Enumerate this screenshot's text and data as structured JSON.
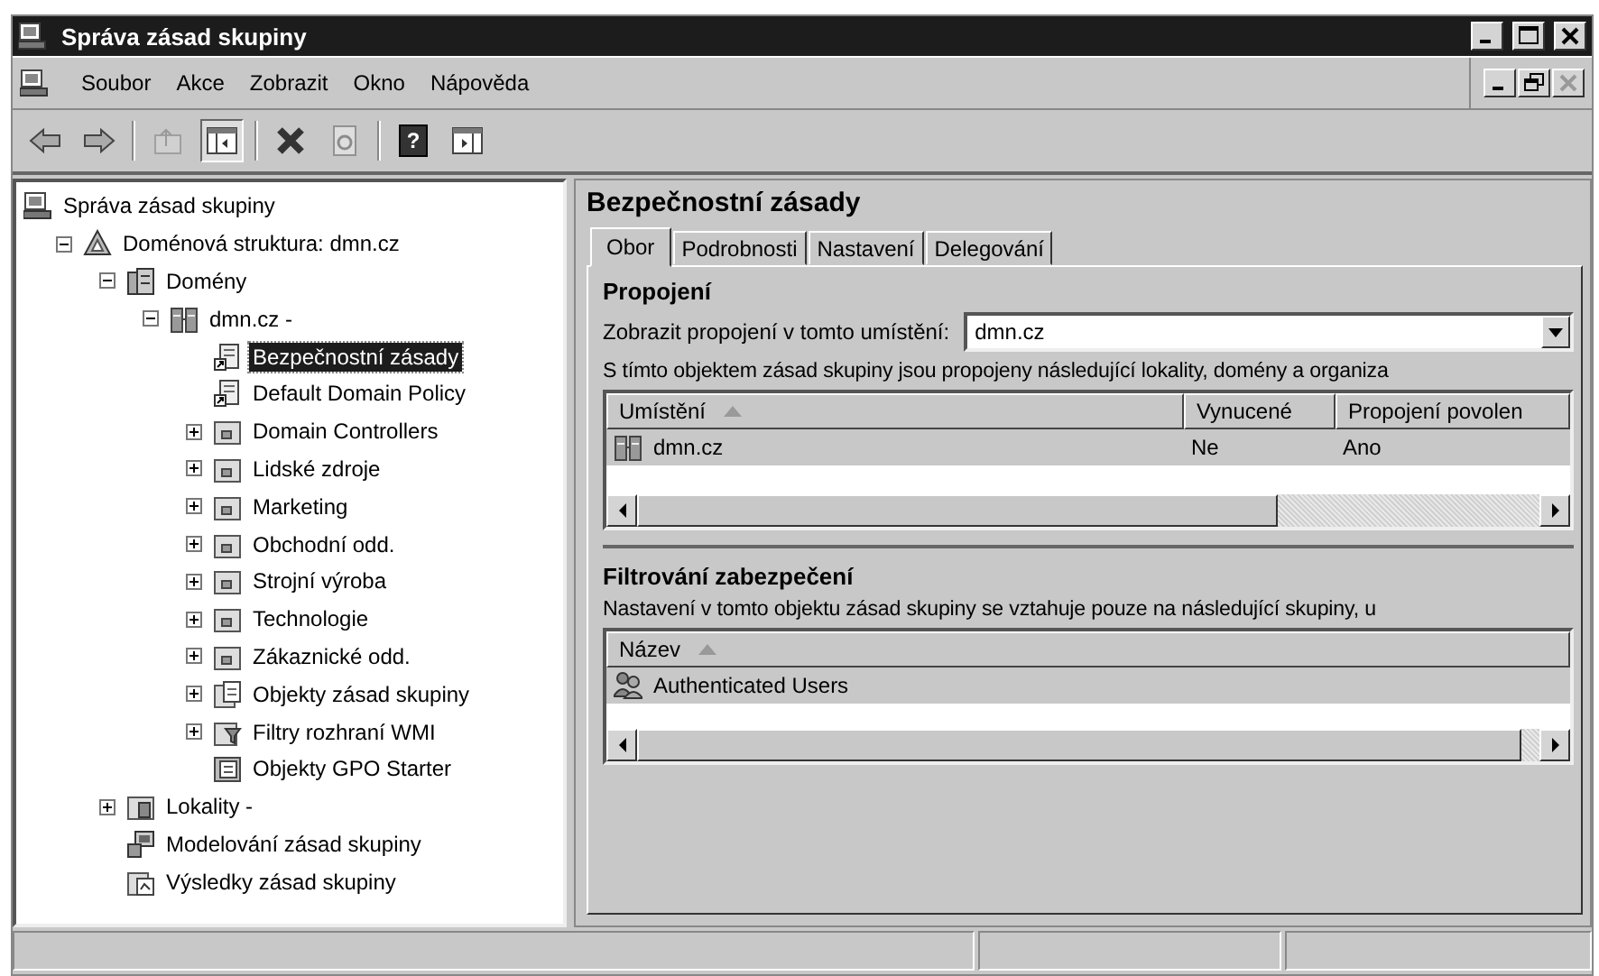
{
  "window": {
    "title": "Správa zásad skupiny"
  },
  "menu": [
    "Soubor",
    "Akce",
    "Zobrazit",
    "Okno",
    "Nápověda"
  ],
  "toolbar": [
    {
      "kind": "back",
      "disabled": false,
      "pressed": false
    },
    {
      "kind": "forward",
      "disabled": false,
      "pressed": false
    },
    {
      "kind": "separator"
    },
    {
      "kind": "up",
      "disabled": true,
      "pressed": false
    },
    {
      "kind": "tree-toggle",
      "disabled": false,
      "pressed": true
    },
    {
      "kind": "separator"
    },
    {
      "kind": "delete",
      "disabled": false,
      "pressed": false
    },
    {
      "kind": "refresh",
      "disabled": true,
      "pressed": false
    },
    {
      "kind": "separator"
    },
    {
      "kind": "help",
      "disabled": false,
      "pressed": false,
      "glyph": "?"
    },
    {
      "kind": "action-toggle",
      "disabled": false,
      "pressed": false
    }
  ],
  "tree": [
    {
      "label": "Správa zásad skupiny",
      "kind": "console",
      "selected": false,
      "children": [
        {
          "label": "Doménová struktura: dmn.cz",
          "kind": "forest",
          "expanded": true,
          "selected": false,
          "children": [
            {
              "label": "Domény",
              "kind": "domains",
              "expanded": true,
              "selected": false,
              "children": [
                {
                  "label": "dmn.cz -",
                  "kind": "domain",
                  "expanded": true,
                  "selected": false,
                  "children": [
                    {
                      "label": "Bezpečnostní zásady",
                      "kind": "gpo-link",
                      "selected": true
                    },
                    {
                      "label": "Default Domain Policy",
                      "kind": "gpo-link",
                      "selected": false
                    },
                    {
                      "label": "Domain Controllers",
                      "kind": "ou",
                      "expanded": false,
                      "selected": false
                    },
                    {
                      "label": "Lidské zdroje",
                      "kind": "ou",
                      "expanded": false,
                      "selected": false
                    },
                    {
                      "label": "Marketing",
                      "kind": "ou",
                      "expanded": false,
                      "selected": false
                    },
                    {
                      "label": "Obchodní odd.",
                      "kind": "ou",
                      "expanded": false,
                      "selected": false
                    },
                    {
                      "label": "Strojní výroba",
                      "kind": "ou",
                      "expanded": false,
                      "selected": false
                    },
                    {
                      "label": "Technologie",
                      "kind": "ou",
                      "expanded": false,
                      "selected": false
                    },
                    {
                      "label": "Zákaznické odd.",
                      "kind": "ou",
                      "expanded": false,
                      "selected": false
                    },
                    {
                      "label": "Objekty zásad skupiny",
                      "kind": "gpo-folder",
                      "expanded": false,
                      "selected": false
                    },
                    {
                      "label": "Filtry rozhraní WMI",
                      "kind": "wmi-folder",
                      "expanded": false,
                      "selected": false
                    },
                    {
                      "label": "Objekty GPO Starter",
                      "kind": "starter",
                      "selected": false
                    }
                  ]
                }
              ]
            },
            {
              "label": "Lokality -",
              "kind": "sites",
              "expanded": false,
              "selected": false
            },
            {
              "label": "Modelování zásad skupiny",
              "kind": "modeling",
              "selected": false
            },
            {
              "label": "Výsledky zásad skupiny",
              "kind": "results",
              "selected": false
            }
          ]
        }
      ]
    }
  ],
  "details": {
    "title": "Bezpečnostní zásady",
    "tabs": [
      {
        "label": "Obor",
        "selected": true
      },
      {
        "label": "Podrobnosti",
        "selected": false
      },
      {
        "label": "Nastavení",
        "selected": false
      },
      {
        "label": "Delegování",
        "selected": false
      }
    ],
    "sections": [
      {
        "heading": "Propojení",
        "combo": {
          "label": "Zobrazit propojení v tomto umístění:",
          "value": "dmn.cz"
        },
        "text": "S tímto objektem zásad skupiny jsou propojeny následující lokality, domény a organiza",
        "columns": [
          {
            "label": "Umístění",
            "sorted": true
          },
          {
            "label": "Vynucené",
            "sorted": false
          },
          {
            "label": "Propojení povolen",
            "sorted": false
          }
        ],
        "rows": [
          {
            "kind": "domain",
            "selected": true,
            "cells": [
              "dmn.cz",
              "Ne",
              "Ano"
            ]
          }
        ]
      },
      {
        "heading": "Filtrování zabezpečení",
        "text": "Nastavení v tomto objektu zásad skupiny se vztahuje pouze na následující skupiny, u",
        "columns": [
          {
            "label": "Název",
            "sorted": true
          }
        ],
        "rows": [
          {
            "kind": "users",
            "selected": true,
            "cells": [
              "Authenticated Users"
            ]
          }
        ]
      }
    ]
  }
}
